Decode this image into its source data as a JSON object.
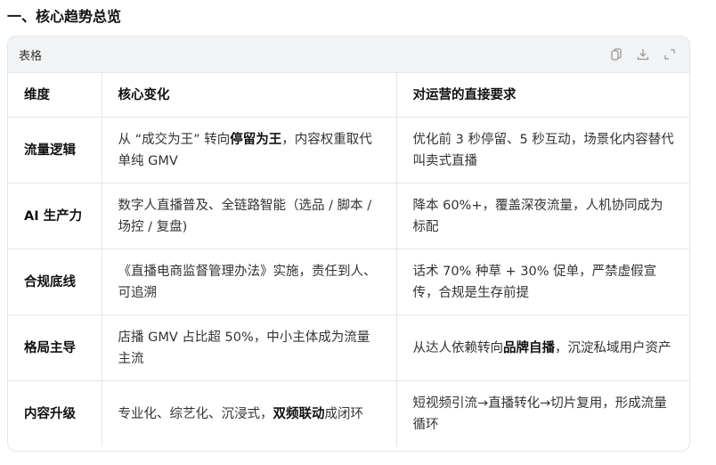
{
  "heading": "一、核心趋势总览",
  "card": {
    "label": "表格",
    "icons": [
      "copy-icon",
      "download-icon",
      "expand-icon"
    ]
  },
  "table": {
    "headers": [
      "维度",
      "核心变化",
      "对运营的直接要求"
    ],
    "rows": [
      {
        "dim": "流量逻辑",
        "change": [
          {
            "t": "从 “成交为王” 转向"
          },
          {
            "t": "停留为王",
            "b": true
          },
          {
            "t": "，内容权重取代单纯 GMV"
          }
        ],
        "req": [
          {
            "t": "优化前 3 秒停留、5 秒互动，场景化内容替代叫卖式直播"
          }
        ]
      },
      {
        "dim": "AI 生产力",
        "change": [
          {
            "t": "数字人直播普及、全链路智能（选品 / 脚本 / 场控 / 复盘)"
          }
        ],
        "req": [
          {
            "t": "降本 60%+，覆盖深夜流量，人机协同成为标配"
          }
        ]
      },
      {
        "dim": "合规底线",
        "change": [
          {
            "t": "《直播电商监督管理办法》实施，责任到人、可追溯"
          }
        ],
        "req": [
          {
            "t": "话术 70% 种草 + 30% 促单，严禁虚假宣传，合规是生存前提"
          }
        ]
      },
      {
        "dim": "格局主导",
        "change": [
          {
            "t": "店播 GMV 占比超 50%，中小主体成为流量主流"
          }
        ],
        "req": [
          {
            "t": "从达人依赖转向"
          },
          {
            "t": "品牌自播",
            "b": true
          },
          {
            "t": "，沉淀私域用户资产"
          }
        ]
      },
      {
        "dim": "内容升级",
        "change": [
          {
            "t": "专业化、综艺化、沉浸式，"
          },
          {
            "t": "双频联动",
            "b": true
          },
          {
            "t": "成闭环"
          }
        ],
        "req": [
          {
            "t": "短视频引流→直播转化→切片复用，形成流量循环"
          }
        ]
      }
    ]
  }
}
